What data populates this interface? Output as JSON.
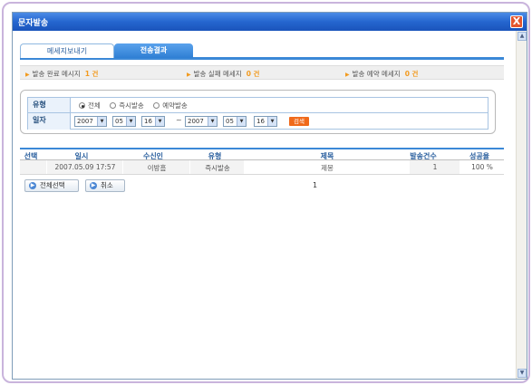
{
  "window": {
    "title": "문자발송",
    "close_label": "X"
  },
  "tabs": [
    {
      "label": "메세지보내기",
      "active": false
    },
    {
      "label": "전송결과",
      "active": true
    }
  ],
  "summary": [
    {
      "label": "발송 완료 메시지",
      "count": "1 건"
    },
    {
      "label": "발송 실패 메세지",
      "count": "0 건"
    },
    {
      "label": "발송 예약 메세지",
      "count": "0 건"
    }
  ],
  "filter": {
    "type_label": "유형",
    "type_options": [
      "전체",
      "즉시발송",
      "예약발송"
    ],
    "type_selected": "전체",
    "date_label": "일자",
    "from": {
      "year": "2007",
      "month": "05",
      "day": "16"
    },
    "range_sep": "~",
    "to": {
      "year": "2007",
      "month": "05",
      "day": "16"
    },
    "search_label": "검색"
  },
  "table": {
    "headers": [
      "선택",
      "일시",
      "수신인",
      "유형",
      "제목",
      "발송건수",
      "성공율"
    ],
    "rows": [
      {
        "select": "",
        "datetime": "2007.05.09 17:57",
        "recipient": "이방흠",
        "type": "즉시발송",
        "subject": "제몽",
        "count": "1",
        "rate": "100 %"
      }
    ]
  },
  "buttons": {
    "select_all": "전체선택",
    "cancel": "취소"
  },
  "pagination": {
    "current": "1"
  },
  "colors": {
    "accent": "#3b88d7",
    "highlight": "#f29a1e",
    "title_bar": "#2566cf",
    "search_button": "#f06a1b"
  }
}
